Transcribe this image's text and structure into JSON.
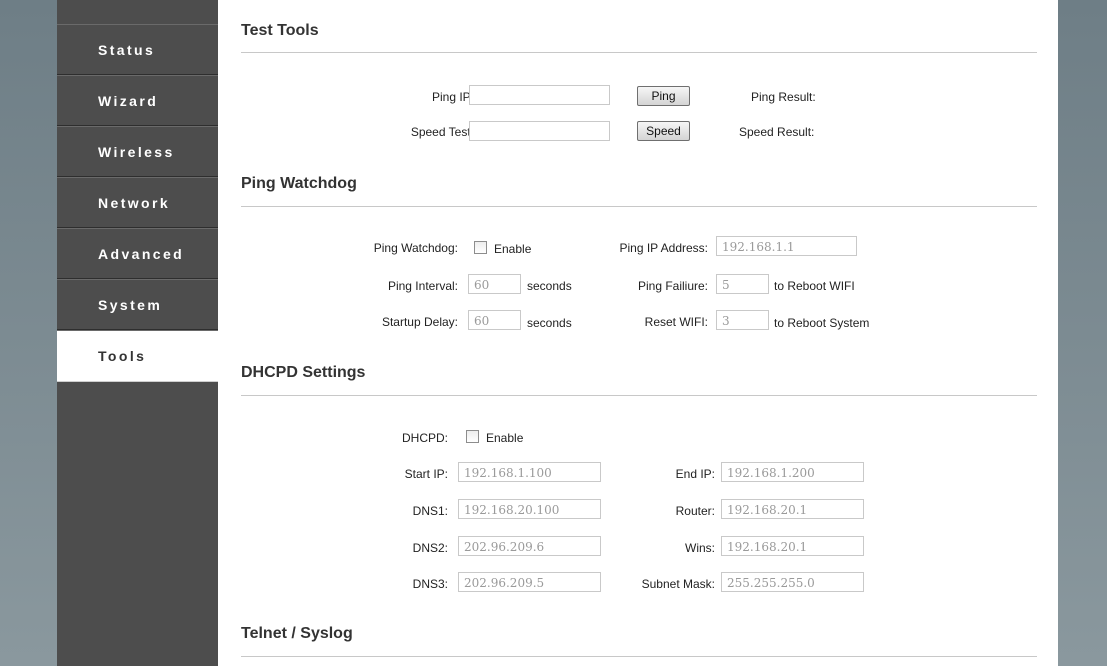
{
  "nav": {
    "items": [
      {
        "label": "Status"
      },
      {
        "label": "Wizard"
      },
      {
        "label": "Wireless"
      },
      {
        "label": "Network"
      },
      {
        "label": "Advanced"
      },
      {
        "label": "System"
      },
      {
        "label": "Tools",
        "active": true
      }
    ]
  },
  "test_tools": {
    "title": "Test Tools",
    "ping_label": "Ping IP:",
    "ping_value": "",
    "ping_button": "Ping",
    "ping_result_label": "Ping Result:",
    "speed_label": "Speed Test:",
    "speed_value": "",
    "speed_button": "Speed",
    "speed_result_label": "Speed Result:"
  },
  "watchdog": {
    "title": "Ping Watchdog",
    "enable_label": "Ping Watchdog:",
    "enable_text": "Enable",
    "enabled": false,
    "interval_label": "Ping Interval:",
    "interval_value": "60",
    "interval_unit": "seconds",
    "delay_label": "Startup Delay:",
    "delay_value": "60",
    "delay_unit": "seconds",
    "ip_label": "Ping IP Address:",
    "ip_value": "192.168.1.1",
    "failure_label": "Ping Failiure:",
    "failure_value": "5",
    "failure_unit": "to Reboot WIFI",
    "reset_label": "Reset WIFI:",
    "reset_value": "3",
    "reset_unit": "to Reboot System"
  },
  "dhcpd": {
    "title": "DHCPD Settings",
    "enable_label": "DHCPD:",
    "enable_text": "Enable",
    "enabled": false,
    "start_ip_label": "Start IP:",
    "start_ip_value": "192.168.1.100",
    "end_ip_label": "End IP:",
    "end_ip_value": "192.168.1.200",
    "dns1_label": "DNS1:",
    "dns1_value": "192.168.20.100",
    "router_label": "Router:",
    "router_value": "192.168.20.1",
    "dns2_label": "DNS2:",
    "dns2_value": "202.96.209.6",
    "wins_label": "Wins:",
    "wins_value": "192.168.20.1",
    "dns3_label": "DNS3:",
    "dns3_value": "202.96.209.5",
    "subnet_label": "Subnet Mask:",
    "subnet_value": "255.255.255.0"
  },
  "telnet": {
    "title": "Telnet / Syslog"
  }
}
